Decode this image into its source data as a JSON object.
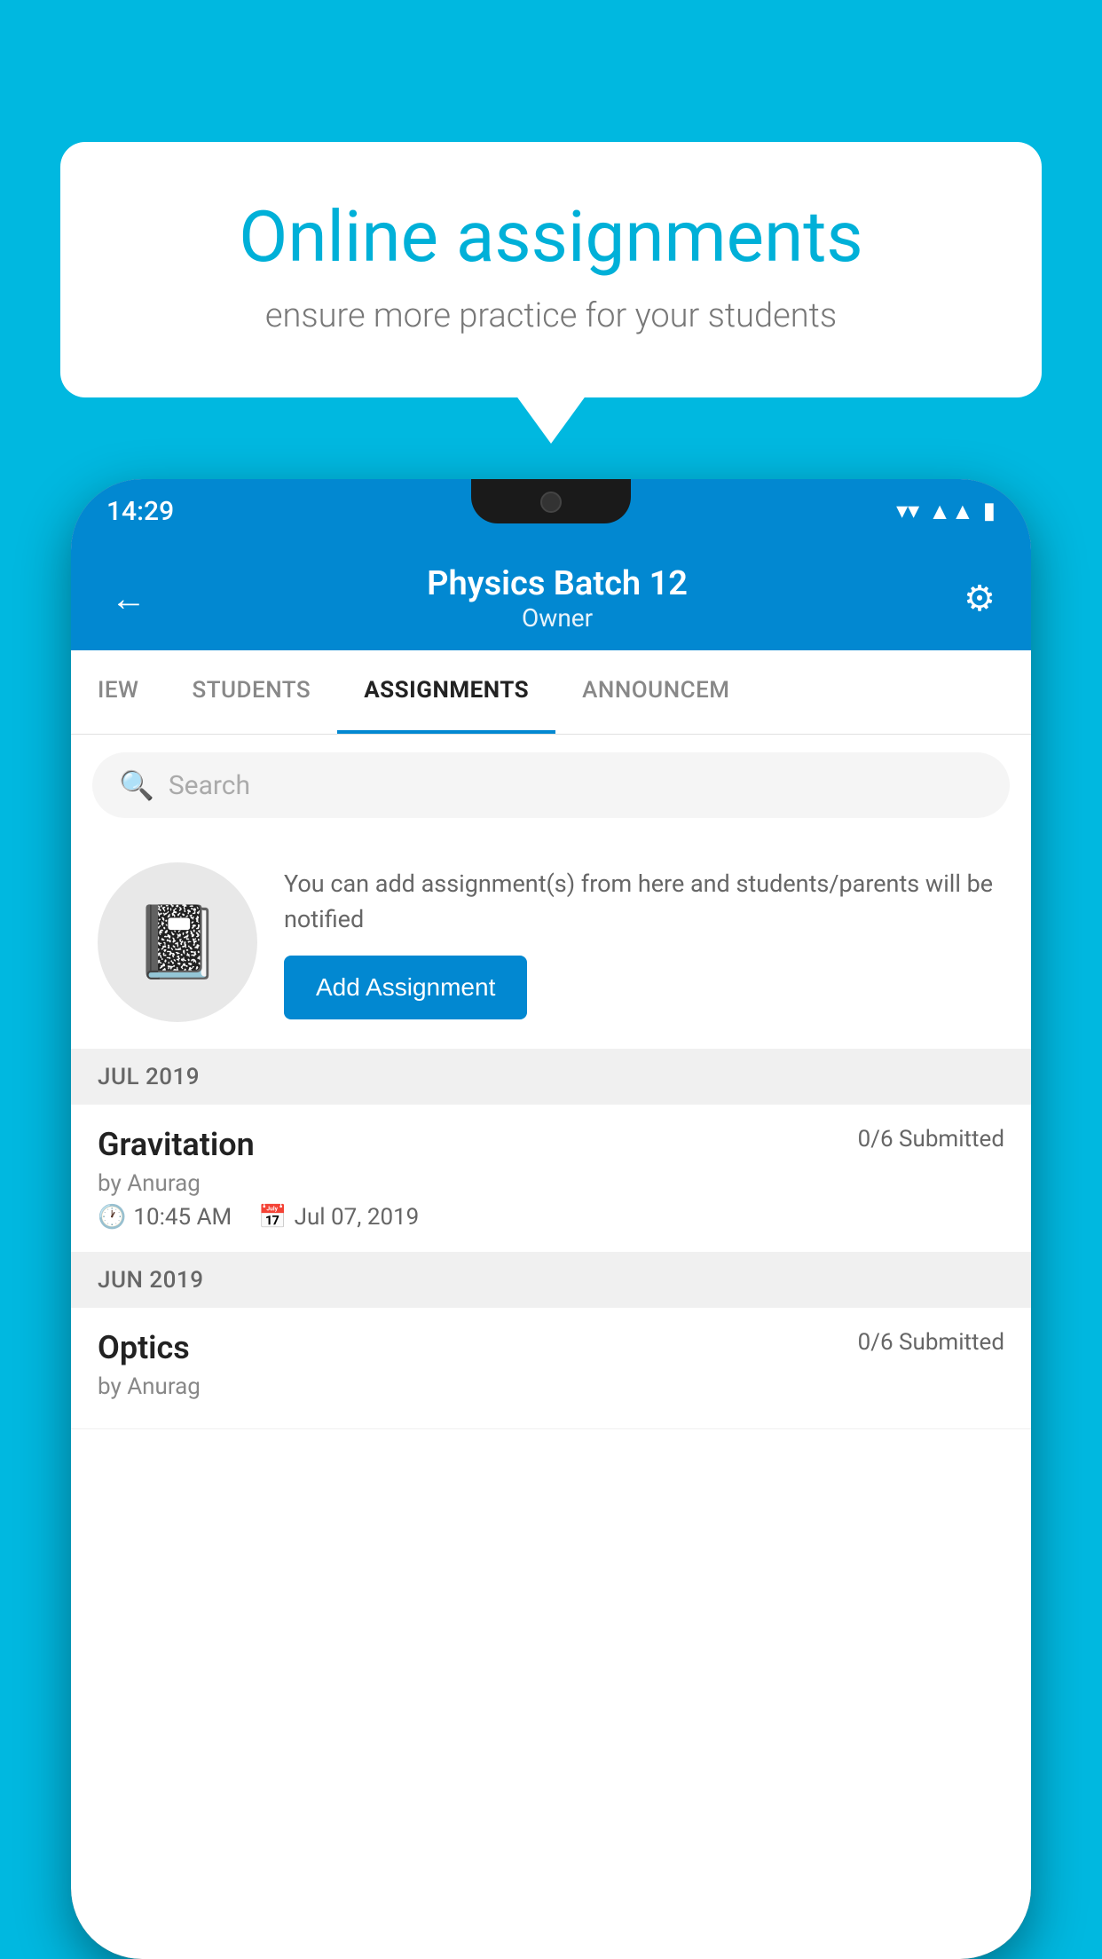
{
  "background_color": "#00b8e0",
  "bubble": {
    "title": "Online assignments",
    "subtitle": "ensure more practice for your students"
  },
  "phone": {
    "status_bar": {
      "time": "14:29",
      "icons": [
        "wifi",
        "signal",
        "battery"
      ]
    },
    "header": {
      "title": "Physics Batch 12",
      "subtitle": "Owner",
      "back_label": "←",
      "settings_label": "⚙"
    },
    "tabs": [
      {
        "label": "IEW",
        "active": false
      },
      {
        "label": "STUDENTS",
        "active": false
      },
      {
        "label": "ASSIGNMENTS",
        "active": true
      },
      {
        "label": "ANNOUNCEM",
        "active": false
      }
    ],
    "search": {
      "placeholder": "Search"
    },
    "promo": {
      "text": "You can add assignment(s) from here and students/parents will be notified",
      "button_label": "Add Assignment"
    },
    "sections": [
      {
        "month": "JUL 2019",
        "assignments": [
          {
            "name": "Gravitation",
            "submitted": "0/6 Submitted",
            "by": "by Anurag",
            "time": "10:45 AM",
            "date": "Jul 07, 2019"
          }
        ]
      },
      {
        "month": "JUN 2019",
        "assignments": [
          {
            "name": "Optics",
            "submitted": "0/6 Submitted",
            "by": "by Anurag",
            "time": "",
            "date": ""
          }
        ]
      }
    ]
  }
}
